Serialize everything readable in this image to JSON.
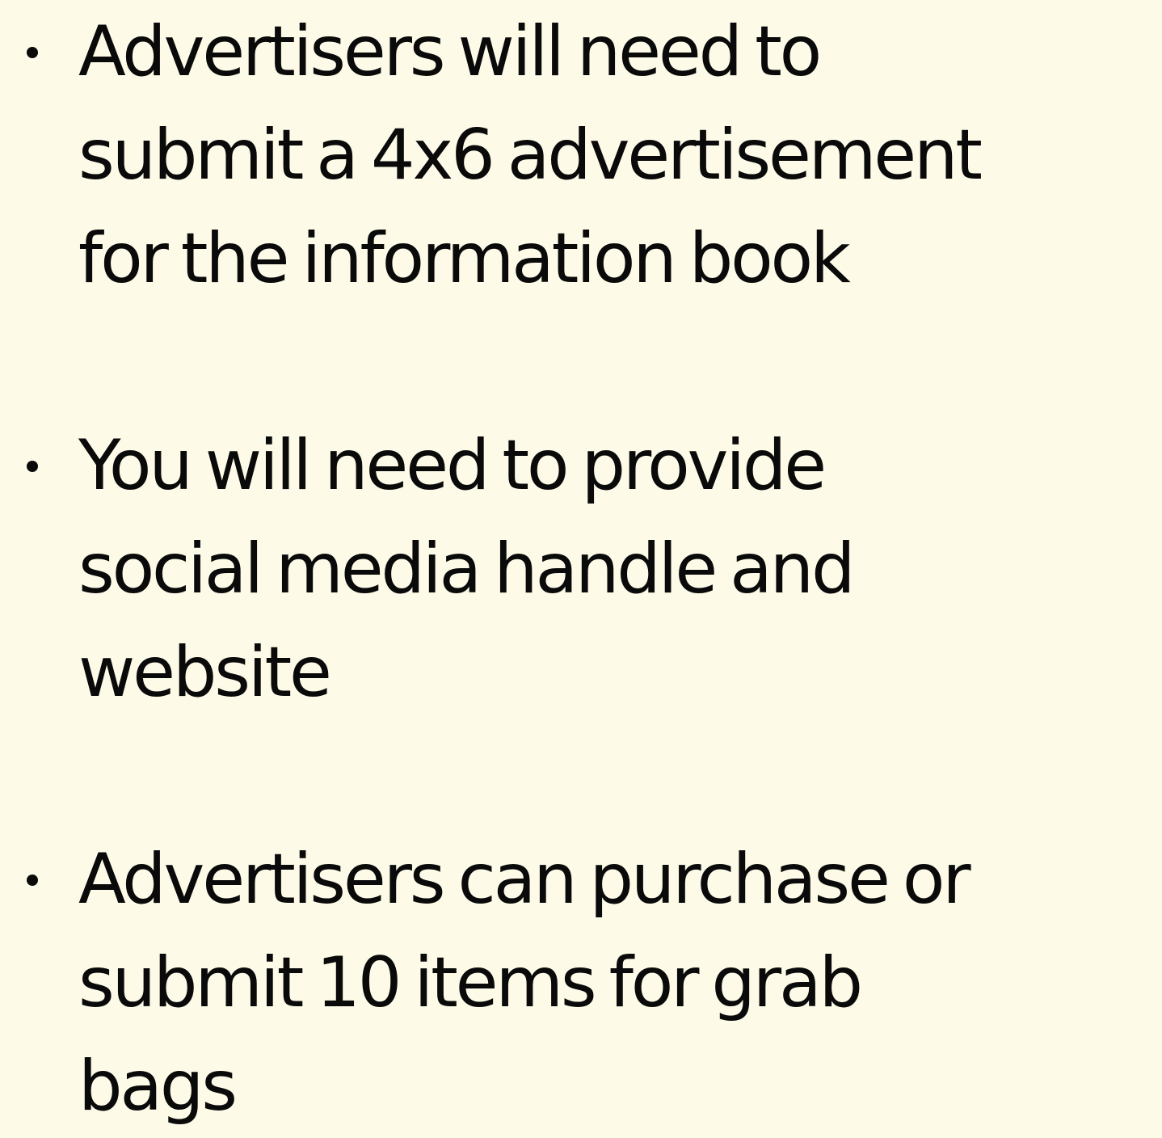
{
  "bullets": [
    "Advertisers will need to\nsubmit a 4x6 advertisement\nfor the information book",
    "You will need to provide\nsocial media handle and\nwebsite",
    "Advertisers can purchase or\nsubmit 10 items for grab\nbags"
  ],
  "colors": {
    "background": "#fdfbe8",
    "text": "#0a0a0a"
  }
}
